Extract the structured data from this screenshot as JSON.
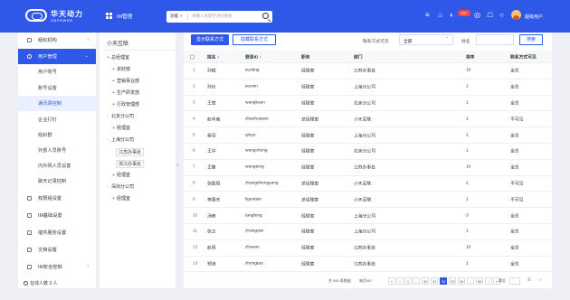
{
  "brand": {
    "name": "华天动力",
    "sub": "CNPOWER"
  },
  "module": {
    "label": "IM管理"
  },
  "search": {
    "type": "功能",
    "placeholder": "请输入关键字进行搜索"
  },
  "header": {
    "badge": "99+",
    "username": "超级用户"
  },
  "sidebar": {
    "items": [
      {
        "label": "组织机构",
        "arrow": "›"
      },
      {
        "label": "用户管理",
        "arrow": "⌄"
      },
      {
        "label": "用户账号"
      },
      {
        "label": "账号设置"
      },
      {
        "label": "通讯录控制"
      },
      {
        "label": "企业打钉"
      },
      {
        "label": "组织群"
      },
      {
        "label": "外部人员账号"
      },
      {
        "label": "内外网人员设置"
      },
      {
        "label": "聊天记录控制"
      },
      {
        "label": "权限组设置"
      },
      {
        "label": "IM基础设置"
      },
      {
        "label": "插件服务设置"
      },
      {
        "label": "文档设置"
      },
      {
        "label": "IM安全控制",
        "arrow": "›"
      }
    ],
    "online": "在线人数 3 人"
  },
  "tree": {
    "title": "小天互联",
    "nodes": [
      {
        "label": "总经理室",
        "toggle": "+"
      },
      {
        "label": "资财部",
        "toggle": "+"
      },
      {
        "label": "营销事业部",
        "toggle": "+"
      },
      {
        "label": "生产研发部",
        "toggle": "+"
      },
      {
        "label": "行政管理部",
        "toggle": "+"
      },
      {
        "label": "北京分公司",
        "toggle": "-"
      },
      {
        "label": "经理室",
        "toggle": "+"
      },
      {
        "label": "上海分公司",
        "toggle": "-"
      },
      {
        "label": "江苏办事处",
        "toggle": ""
      },
      {
        "label": "浙江办事处",
        "toggle": ""
      },
      {
        "label": "经理室",
        "toggle": "+"
      },
      {
        "label": "深圳分公司",
        "toggle": "-"
      },
      {
        "label": "经理室",
        "toggle": "+"
      }
    ]
  },
  "toolbar": {
    "show_btn": "显示联系方式",
    "hide_btn": "隐藏联系方式",
    "contact_label": "联系方式可见",
    "contact_value": "全部",
    "name_label": "姓名",
    "search_btn": "搜索"
  },
  "table": {
    "headers": [
      "",
      "姓名 ↕",
      "登录ID ↕",
      "职务",
      "部门",
      "单位",
      "排序",
      "联系方式可见"
    ],
    "rows": [
      [
        "1",
        "孙楹",
        "sunting",
        "经理室",
        "江苏办事处",
        "江苏办事处",
        "10",
        "全员"
      ],
      [
        "2",
        "孙信",
        "sunxin",
        "经理室",
        "上海分公司",
        "上海分公司",
        "1",
        "全员"
      ],
      [
        "3",
        "王宽",
        "wangkuan",
        "经理室",
        "北京分公司",
        "北京分公司",
        "1",
        "全员"
      ],
      [
        "4",
        "赵华威",
        "zhaohuawei",
        "总经理室",
        "总经理室",
        "小天互联",
        "1",
        "不可见"
      ],
      [
        "5",
        "秦羽",
        "qinyu",
        "经理室",
        "上海分公司",
        "上海分公司",
        "2",
        "全员"
      ],
      [
        "6",
        "王冲",
        "wangchong",
        "经理室",
        "北京分公司",
        "北京分公司",
        "1",
        "全员"
      ],
      [
        "7",
        "王滕",
        "wangteng",
        "经理室",
        "江苏办事处",
        "江苏办事处",
        "10",
        "全员"
      ],
      [
        "8",
        "张胜阳",
        "zhangshengyang",
        "总经理室",
        "总经理室",
        "小天互联",
        "2",
        "不可见"
      ],
      [
        "9",
        "李国天",
        "liguotian",
        "总经理室",
        "总经理室",
        "小天互联",
        "1",
        "不可见"
      ],
      [
        "10",
        "汤峰",
        "tangfeng",
        "经理室",
        "上海分公司",
        "上海分公司",
        "3",
        "全员"
      ],
      [
        "11",
        "张卫",
        "zhangwei",
        "经理室",
        "上海分公司",
        "上海分公司",
        "1",
        "全员"
      ],
      [
        "12",
        "赵阳",
        "zhaoan",
        "经理室",
        "江苏办事处",
        "江苏办事处",
        "10",
        "全员"
      ],
      [
        "13",
        "郑涛",
        "zhengtao",
        "经理室",
        "江苏办事处",
        "江苏办事处",
        "1",
        "全员"
      ]
    ]
  },
  "pager": {
    "total": "共 600 条数据",
    "per_page": "每页/50",
    "pages": [
      "«",
      "‹",
      "1",
      "...",
      "30",
      "31",
      "32",
      "33",
      "34",
      "...",
      "60",
      "›",
      "»"
    ],
    "jump": "跳至"
  }
}
